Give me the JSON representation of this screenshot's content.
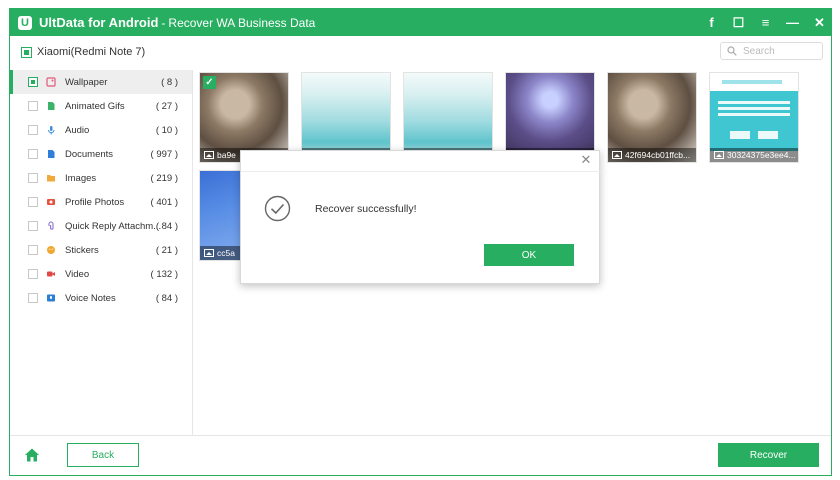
{
  "titlebar": {
    "app_name": "UltData for Android",
    "separator": "-",
    "subtitle": "Recover WA Business Data",
    "logo_letter": "U",
    "actions": [
      {
        "name": "facebook-icon",
        "glyph": "f"
      },
      {
        "name": "feedback-icon",
        "glyph": "☐"
      },
      {
        "name": "menu-icon",
        "glyph": "≡"
      },
      {
        "name": "minimize-icon",
        "glyph": "—"
      },
      {
        "name": "close-icon",
        "glyph": "✕"
      }
    ]
  },
  "device": {
    "name": "Xiaomi(Redmi Note 7)",
    "selected": true
  },
  "search": {
    "placeholder": "Search"
  },
  "sidebar": {
    "items": [
      {
        "label": "Wallpaper",
        "count": "( 8 )",
        "icon": "wallpaper-icon",
        "icon_color": "#e05a7a",
        "active": true,
        "checked": true
      },
      {
        "label": "Animated Gifs",
        "count": "( 27 )",
        "icon": "gif-icon",
        "icon_color": "#3bb36a"
      },
      {
        "label": "Audio",
        "count": "( 10 )",
        "icon": "audio-icon",
        "icon_color": "#3b8ee0"
      },
      {
        "label": "Documents",
        "count": "( 997 )",
        "icon": "document-icon",
        "icon_color": "#2f7fd8"
      },
      {
        "label": "Images",
        "count": "( 219 )",
        "icon": "image-folder-icon",
        "icon_color": "#f2a93b"
      },
      {
        "label": "Profile Photos",
        "count": "( 401 )",
        "icon": "profile-photo-icon",
        "icon_color": "#e5533d"
      },
      {
        "label": "Quick Reply Attachm...",
        "count": "( 84 )",
        "icon": "attachment-icon",
        "icon_color": "#8a6fd1"
      },
      {
        "label": "Stickers",
        "count": "( 21 )",
        "icon": "sticker-icon",
        "icon_color": "#f0a82e"
      },
      {
        "label": "Video",
        "count": "( 132 )",
        "icon": "video-icon",
        "icon_color": "#e04848"
      },
      {
        "label": "Voice Notes",
        "count": "( 84 )",
        "icon": "voice-note-icon",
        "icon_color": "#2b7fd4"
      }
    ]
  },
  "grid": {
    "thumbs": [
      {
        "caption": "ba9e",
        "style": "img-blur",
        "checked": true
      },
      {
        "caption": "",
        "style": "img-jewel"
      },
      {
        "caption": "",
        "style": "img-jewel"
      },
      {
        "caption": "",
        "style": "img-fantasy"
      },
      {
        "caption": "42f694cb01ffcb...",
        "style": "img-blur"
      },
      {
        "caption": "30324375e3ee4...",
        "style": "img-web"
      },
      {
        "caption": "cc5a",
        "style": "img-blue"
      }
    ]
  },
  "dialog": {
    "message": "Recover successfully!",
    "ok_label": "OK",
    "close_glyph": "✕"
  },
  "footer": {
    "back_label": "Back",
    "recover_label": "Recover"
  },
  "colors": {
    "accent": "#27ae60"
  }
}
